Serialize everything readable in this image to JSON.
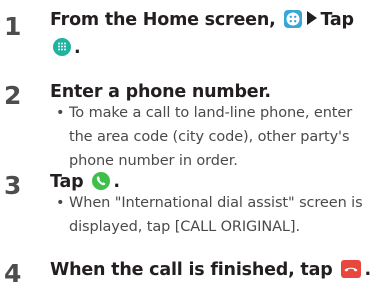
{
  "steps": [
    {
      "number": "1",
      "text_before_icon": "From the Home screen,",
      "icon_1": "apps-icon",
      "text_after_arrow": "Tap",
      "icon_2": "dial-icon",
      "text_end": "."
    },
    {
      "number": "2",
      "text": "Enter a phone number.",
      "note": "To make a call to land-line phone, enter the area code (city code), other party's phone number in order."
    },
    {
      "number": "3",
      "text_before_icon": "Tap",
      "icon": "call-icon",
      "text_end": ".",
      "note": "When \"International dial assist\" screen is displayed, tap [CALL ORIGINAL]."
    },
    {
      "number": "4",
      "text_before_icon": "When the call is finished, tap",
      "icon": "end-call-icon",
      "text_end": "."
    }
  ],
  "bullet": "•",
  "colors": {
    "text": "#231f20",
    "note": "#4a4a4a",
    "number": "#4d4d4d",
    "apps_icon": "#3aa6d8",
    "dial_icon": "#1fb3a0",
    "call_icon": "#3fbf4a",
    "end_call_icon": "#e8473d"
  }
}
